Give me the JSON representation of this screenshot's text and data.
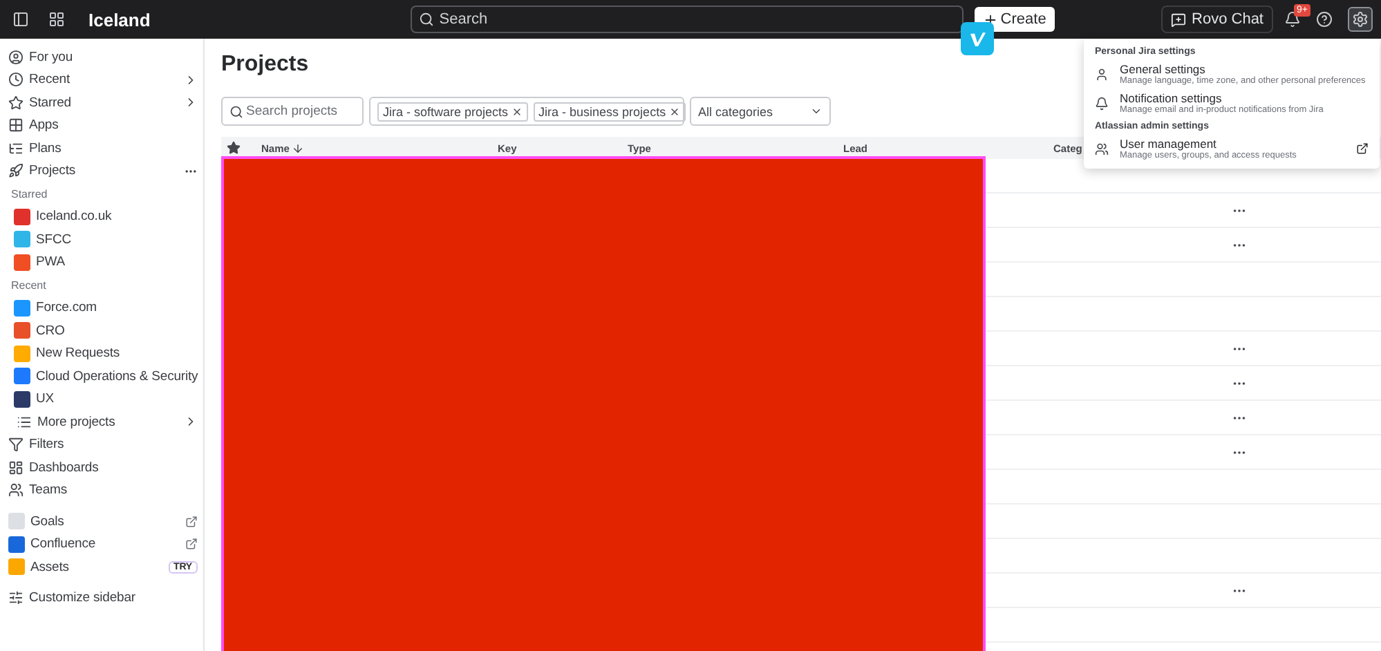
{
  "topbar": {
    "site_name": "Iceland",
    "search": {
      "placeholder": "Search"
    },
    "create_label": "Create",
    "rovo_label": "Rovo Chat",
    "notification_badge": "9+",
    "settings_open": true
  },
  "sidebar": {
    "items": [
      {
        "kind": "nav",
        "label": "For you",
        "chevron": false,
        "more": false
      },
      {
        "kind": "nav",
        "label": "Recent",
        "chevron": true,
        "more": false
      },
      {
        "kind": "nav",
        "label": "Starred",
        "chevron": true,
        "more": false
      },
      {
        "kind": "nav",
        "label": "Apps",
        "chevron": false,
        "more": false
      },
      {
        "kind": "nav",
        "label": "Plans",
        "chevron": false,
        "more": false
      },
      {
        "kind": "nav",
        "label": "Projects",
        "chevron": false,
        "more": true
      },
      {
        "kind": "section",
        "label": "Starred"
      },
      {
        "kind": "project",
        "label": "Iceland.co.uk",
        "color": "#e0312d"
      },
      {
        "kind": "project",
        "label": "SFCC",
        "color": "#2fb5e8"
      },
      {
        "kind": "project",
        "label": "PWA",
        "color": "#f04e23"
      },
      {
        "kind": "section",
        "label": "Recent"
      },
      {
        "kind": "project",
        "label": "Force.com",
        "color": "#1b96ff"
      },
      {
        "kind": "project",
        "label": "CRO",
        "color": "#e8502a"
      },
      {
        "kind": "project",
        "label": "New Requests",
        "color": "#ffab00"
      },
      {
        "kind": "project",
        "label": "Cloud Operations & Security",
        "color": "#1d7afc"
      },
      {
        "kind": "project",
        "label": "UX",
        "color": "#2b3a67"
      },
      {
        "kind": "subnav",
        "label": "More projects",
        "chevron": true,
        "more": false
      },
      {
        "kind": "nav",
        "label": "Filters",
        "chevron": false,
        "more": false
      },
      {
        "kind": "nav",
        "label": "Dashboards",
        "chevron": false,
        "more": false
      },
      {
        "kind": "nav",
        "label": "Teams",
        "chevron": false,
        "more": false
      },
      {
        "kind": "gap"
      },
      {
        "kind": "app",
        "label": "Goals",
        "external": true,
        "color": "#dcdfe4"
      },
      {
        "kind": "app",
        "label": "Confluence",
        "external": true,
        "color": "#1868db"
      },
      {
        "kind": "app",
        "label": "Assets",
        "external": false,
        "badge": "TRY",
        "color": "#fca700"
      },
      {
        "kind": "gap"
      },
      {
        "kind": "nav",
        "label": "Customize sidebar",
        "chevron": false,
        "more": false
      }
    ]
  },
  "page": {
    "title": "Projects",
    "search": {
      "placeholder": "Search projects"
    },
    "type_filter": {
      "chips": [
        "Jira - software projects",
        "Jira - business projects"
      ]
    },
    "category_filter": {
      "value": "All categories"
    }
  },
  "table": {
    "columns": [
      "Name",
      "Key",
      "Type",
      "Lead",
      "Categ"
    ],
    "rows": [
      {
        "actions": false
      },
      {
        "actions": true
      },
      {
        "actions": true
      },
      {
        "actions": false
      },
      {
        "actions": false
      },
      {
        "actions": true
      },
      {
        "actions": true
      },
      {
        "actions": true
      },
      {
        "actions": true
      },
      {
        "actions": false
      },
      {
        "actions": false
      },
      {
        "actions": false
      },
      {
        "actions": true
      },
      {
        "actions": false
      }
    ]
  },
  "settings_menu": {
    "sections": [
      {
        "heading": "Personal Jira settings",
        "items": [
          {
            "title": "General settings",
            "description": "Manage language, time zone, and other personal preferences",
            "external": false
          },
          {
            "title": "Notification settings",
            "description": "Manage email and in-product notifications from Jira",
            "external": false
          }
        ]
      },
      {
        "heading": "Atlassian admin settings",
        "items": [
          {
            "title": "User management",
            "description": "Manage users, groups, and access requests",
            "external": true
          }
        ]
      }
    ]
  }
}
